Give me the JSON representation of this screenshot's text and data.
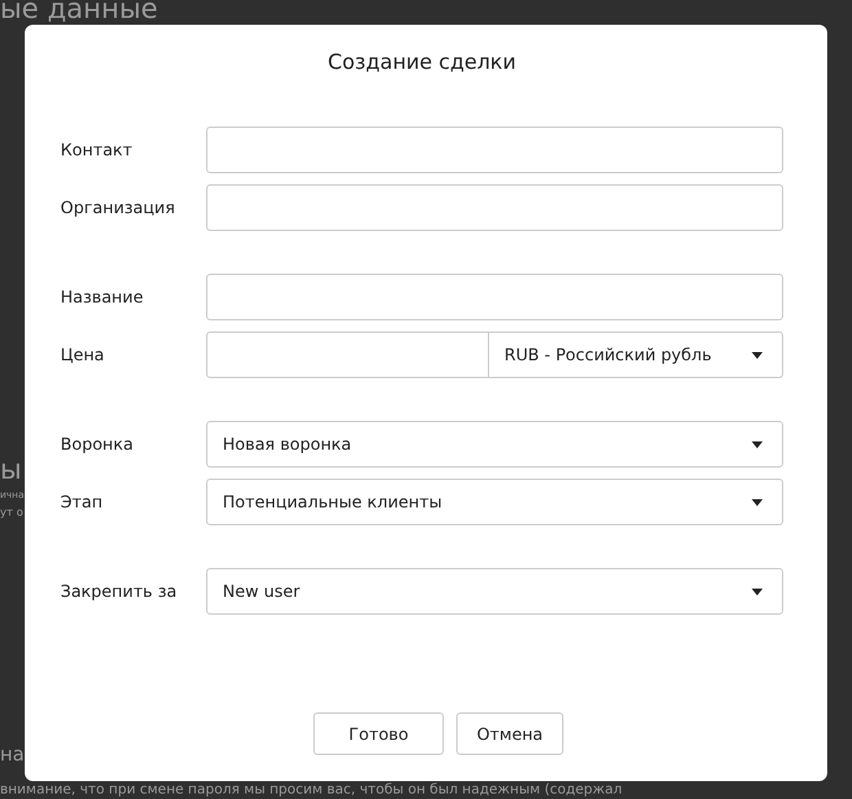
{
  "background": {
    "heading_top": "ые данные",
    "heading_middle": "ы",
    "snippet_1": "ична",
    "snippet_2": "ут о",
    "heading_bottom": "на",
    "notice": "внимание, что при смене пароля мы просим вас, чтобы он был надежным (содержал"
  },
  "dialog": {
    "title": "Создание сделки",
    "groups": [
      [
        {
          "kind": "input",
          "label": "Контакт"
        },
        {
          "kind": "input",
          "label": "Организация"
        }
      ],
      [
        {
          "kind": "input",
          "label": "Название"
        },
        {
          "kind": "price",
          "label": "Цена",
          "currency": "RUB - Российский рубль"
        }
      ],
      [
        {
          "kind": "select",
          "label": "Воронка",
          "value": "Новая воронка"
        },
        {
          "kind": "select",
          "label": "Этап",
          "value": "Потенциальные клиенты"
        }
      ],
      [
        {
          "kind": "select",
          "label": "Закрепить за",
          "value": "New user"
        }
      ]
    ],
    "buttons": [
      "Готово",
      "Отмена"
    ]
  }
}
